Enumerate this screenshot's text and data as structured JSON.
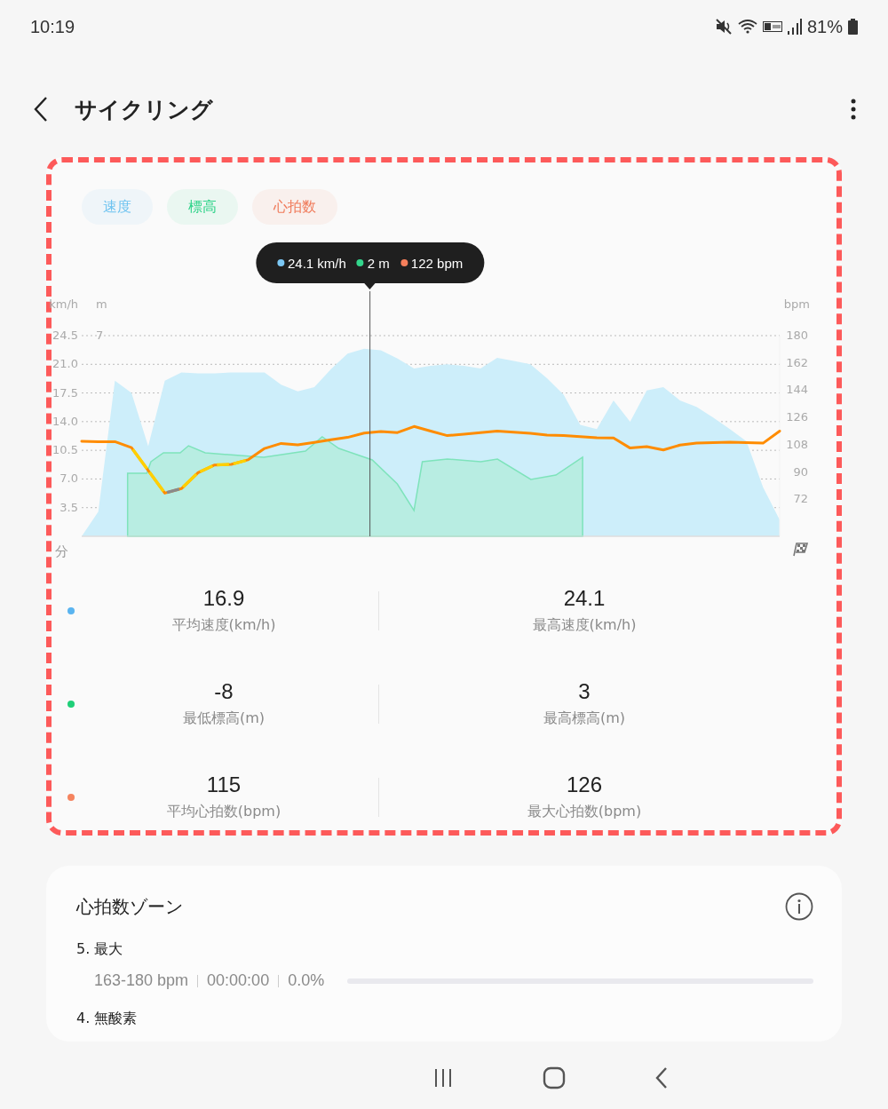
{
  "status_bar": {
    "time": "10:19",
    "battery": "81%"
  },
  "header": {
    "title": "サイクリング"
  },
  "chart_card": {
    "legend": [
      {
        "label": "速度",
        "color": "#6ec3f0"
      },
      {
        "label": "標高",
        "color": "#2fd38a"
      },
      {
        "label": "心拍数",
        "color": "#f07a5a"
      }
    ],
    "tooltip": [
      {
        "text": "24.1 km/h",
        "color": "#7cc8f5"
      },
      {
        "text": "2 m",
        "color": "#33d68c"
      },
      {
        "text": "122 bpm",
        "color": "#f57f5b"
      }
    ],
    "elevation_axis": {
      "unit": "m",
      "tick": "7"
    },
    "speed_chart": {
      "chart_data": {
        "type": "area",
        "xlabel": "分",
        "ylabel": "km/h",
        "grid": true,
        "ylim": [
          0,
          24.5
        ],
        "yticks": [
          {
            "value": 3.5,
            "label": "3.5"
          },
          {
            "value": 7,
            "label": "7.0"
          },
          {
            "value": 10.5,
            "label": "10.5"
          },
          {
            "value": 14,
            "label": "14.0"
          },
          {
            "value": 17.5,
            "label": "17.5"
          },
          {
            "value": 21,
            "label": "21.0"
          },
          {
            "value": 24.5,
            "label": "24.5"
          }
        ],
        "categories": [
          null,
          null,
          null,
          null,
          null,
          null,
          null,
          null,
          null,
          null,
          null,
          null,
          null,
          null,
          null,
          null,
          null,
          null,
          null,
          null,
          null,
          null,
          null,
          null,
          null,
          null,
          null,
          null,
          null,
          null,
          null,
          null,
          null,
          null,
          null,
          null,
          null,
          null,
          null,
          null,
          null,
          null,
          null
        ],
        "series": [
          {
            "color": "#cdeefa",
            "values": [
              0,
              3,
              19,
              17.5,
              11,
              19,
              20,
              19.9,
              19.9,
              20,
              20,
              20,
              18.5,
              17.7,
              18.2,
              20.4,
              22.3,
              22.9,
              22.7,
              21.7,
              20.5,
              20.8,
              21,
              20.8,
              20.5,
              21.8,
              21.4,
              21,
              19.3,
              17.3,
              13.6,
              13.1,
              16.6,
              14,
              17.8,
              18.2,
              16.6,
              15.8,
              14.5,
              13.1,
              11.6,
              6,
              2
            ]
          }
        ]
      }
    },
    "heart_rate_chart": {
      "chart_data": {
        "type": "line",
        "ylabel": "bpm",
        "ylim": [
          47.5,
          180
        ],
        "yticks": [
          {
            "value": 72,
            "label": "72"
          },
          {
            "value": 90,
            "label": "90"
          },
          {
            "value": 108,
            "label": "108"
          },
          {
            "value": 126,
            "label": "126"
          },
          {
            "value": 144,
            "label": "144"
          },
          {
            "value": 162,
            "label": "162"
          },
          {
            "value": 180,
            "label": "180"
          }
        ],
        "categories": [
          null,
          null,
          null,
          null,
          null,
          null,
          null,
          null,
          null,
          null,
          null,
          null,
          null,
          null,
          null,
          null,
          null,
          null,
          null,
          null,
          null,
          null,
          null,
          null,
          null,
          null,
          null,
          null,
          null,
          null,
          null,
          null,
          null,
          null,
          null,
          null,
          null,
          null,
          null,
          null,
          null,
          null,
          null
        ],
        "series": [
          {
            "color": "#ff8c00",
            "values": [
              110.2,
              110,
              110,
              106,
              91,
              76,
              79,
              89.5,
              94.6,
              95,
              98,
              105.5,
              108.8,
              107.8,
              109.5,
              111.3,
              112.8,
              115.6,
              116.6,
              116,
              120,
              117,
              114,
              115,
              116,
              117,
              116.2,
              115.5,
              114.4,
              114,
              113.3,
              112.6,
              112.4,
              105.8,
              106.7,
              104.5,
              107.7,
              109,
              109.3,
              109.6,
              109.3,
              109,
              117
            ]
          }
        ]
      }
    },
    "stats": [
      {
        "color": "#5ab4f0",
        "cells": [
          {
            "value": "16.9",
            "label": "平均速度(km/h)"
          },
          {
            "value": "24.1",
            "label": "最高速度(km/h)"
          }
        ]
      },
      {
        "color": "#1fcf78",
        "cells": [
          {
            "value": "-8",
            "label": "最低標高(m)"
          },
          {
            "value": "3",
            "label": "最高標高(m)"
          }
        ]
      },
      {
        "color": "#f5845f",
        "cells": [
          {
            "value": "115",
            "label": "平均心拍数(bpm)"
          },
          {
            "value": "126",
            "label": "最大心拍数(bpm)"
          }
        ]
      }
    ]
  },
  "hr_zones": {
    "title": "心拍数ゾーン",
    "zones": [
      {
        "name": "5. 最大",
        "range": "163-180 bpm",
        "time": "00:00:00",
        "percent": "0.0%",
        "level": 0
      },
      {
        "name": "4. 無酸素"
      }
    ]
  }
}
